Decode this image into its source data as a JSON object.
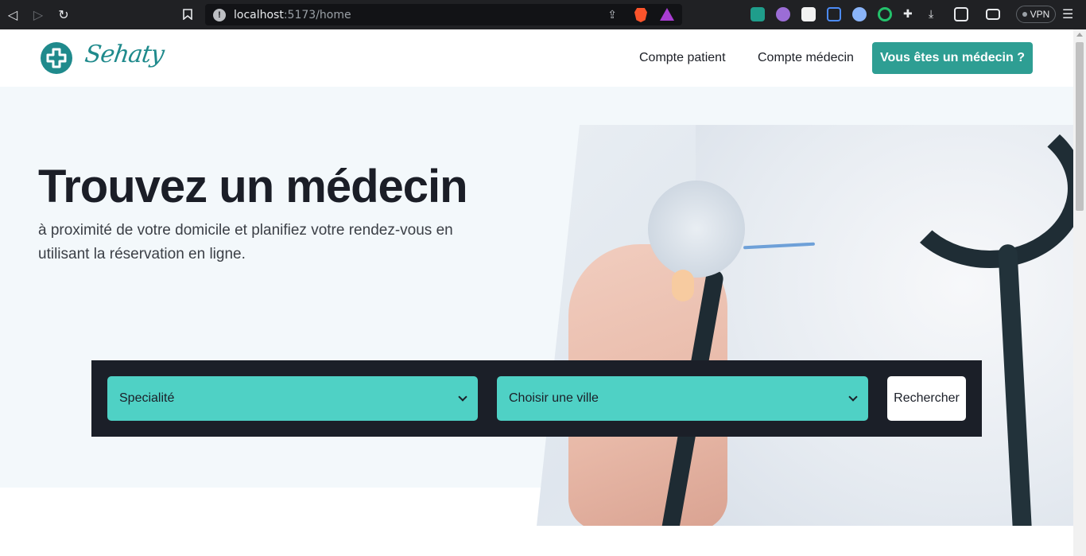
{
  "browser": {
    "url_host": "localhost",
    "url_rest": ":5173/home",
    "vpn_label": "VPN"
  },
  "header": {
    "logo_text": "Sehaty",
    "nav": [
      {
        "label": "Compte patient"
      },
      {
        "label": "Compte médecin"
      }
    ],
    "cta_label": "Vous êtes un médecin ?"
  },
  "hero": {
    "title": "Trouvez un médecin",
    "subtitle": "à proximité de votre domicile et planifiez votre rendez-vous en utilisant la réservation en ligne."
  },
  "search": {
    "specialty_selected": "Specialité",
    "city_selected": "Choisir une ville",
    "button_label": "Rechercher"
  },
  "colors": {
    "brand": "#1f8a8c",
    "cta": "#2e9e93",
    "select_bg": "#4fd1c5",
    "search_bar": "#1b1f28"
  }
}
